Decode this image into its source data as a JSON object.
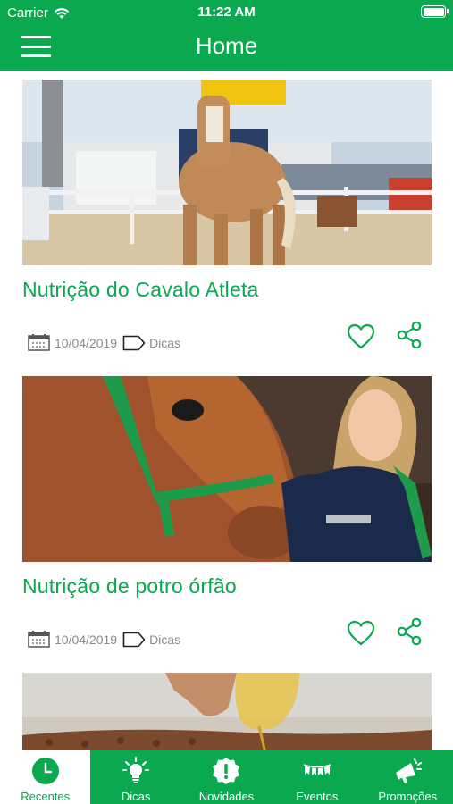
{
  "status_bar": {
    "carrier": "Carrier",
    "time": "11:22 AM"
  },
  "nav": {
    "title": "Home"
  },
  "posts": [
    {
      "title": "Nutrição do Cavalo Atleta",
      "date": "10/04/2019",
      "category": "Dicas"
    },
    {
      "title": "Nutrição de potro órfão",
      "date": "10/04/2019",
      "category": "Dicas"
    }
  ],
  "tabs": [
    {
      "label": "Recentes",
      "icon": "clock-icon"
    },
    {
      "label": "Dicas",
      "icon": "lightbulb-icon"
    },
    {
      "label": "Novidades",
      "icon": "alert-badge-icon"
    },
    {
      "label": "Eventos",
      "icon": "bunting-icon"
    },
    {
      "label": "Promoções",
      "icon": "megaphone-icon"
    }
  ],
  "colors": {
    "brand_green": "#0aa84f",
    "meta_gray": "#8a8a8a"
  }
}
